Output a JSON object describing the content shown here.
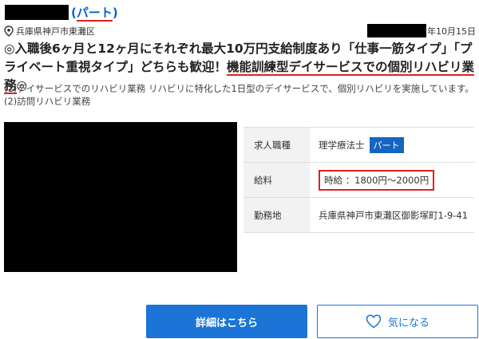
{
  "header": {
    "employment_type": "パート",
    "location": "兵庫県神戸市東灘区",
    "date": "年10月15日"
  },
  "headline": {
    "part1": "◎入職後6ヶ月と12ヶ月にそれぞれ最大10万円支給制度あり「仕事一筋タイプ」「プライベート重視タイプ」どちらも歓迎！",
    "part2_highlight": "機能訓練型デイサービスでの個別リハビリ業務",
    "part3": "◎"
  },
  "description": {
    "line1": "(1)デイサービスでのリハビリ業務 リハビリに特化した1日型のデイサービスで、個別リハビリを実施しています。",
    "line2": "(2)訪問リハビリ業務"
  },
  "info_table": {
    "job_label": "求人職種",
    "job_value": "理学療法士",
    "job_badge": "パート",
    "salary_label": "給料",
    "salary_value": "時給 ：1800円～2000円",
    "location_label": "勤務地",
    "location_value": "兵庫県神戸市東灘区御影塚町1-9-41"
  },
  "buttons": {
    "detail": "詳細はこちら",
    "favorite": "気になる"
  },
  "colors": {
    "accent": "#1b74d6",
    "highlight_red": "#e02020"
  }
}
